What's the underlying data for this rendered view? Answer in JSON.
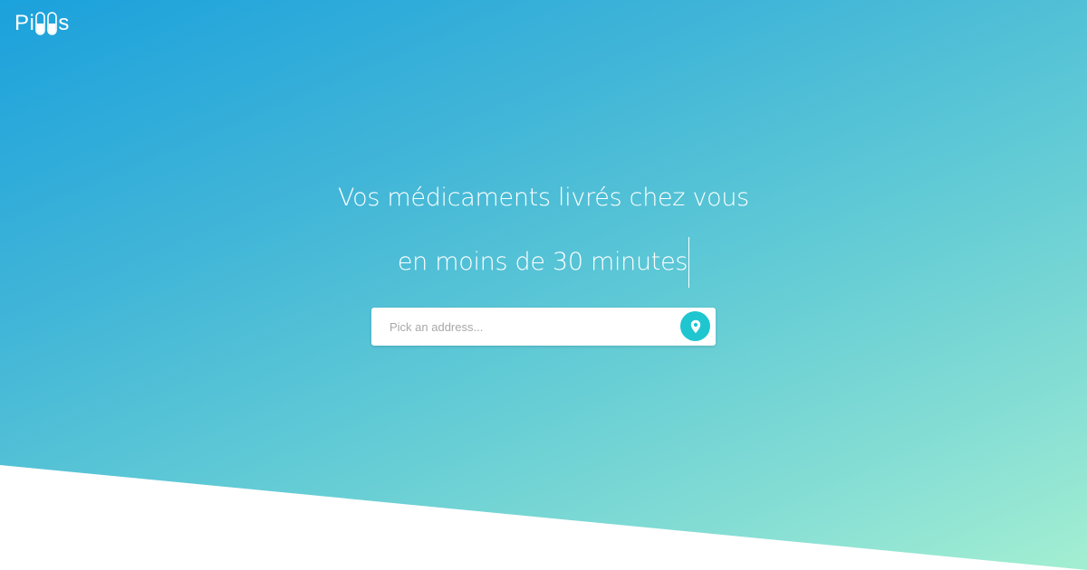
{
  "brand": {
    "name": "Pills",
    "prefix": "Pi",
    "suffix": "s",
    "pill_icon": "capsule-icon"
  },
  "hero": {
    "headline_line1": "Vos médicaments livrés chez vous",
    "headline_line2": "en moins de 30 minutes",
    "gradient_start": "#1ba1dc",
    "gradient_end": "#a3efd2"
  },
  "search": {
    "placeholder": "Pick an address...",
    "value": "",
    "button_icon": "map-pin-icon",
    "button_color": "#1fc6cf"
  }
}
